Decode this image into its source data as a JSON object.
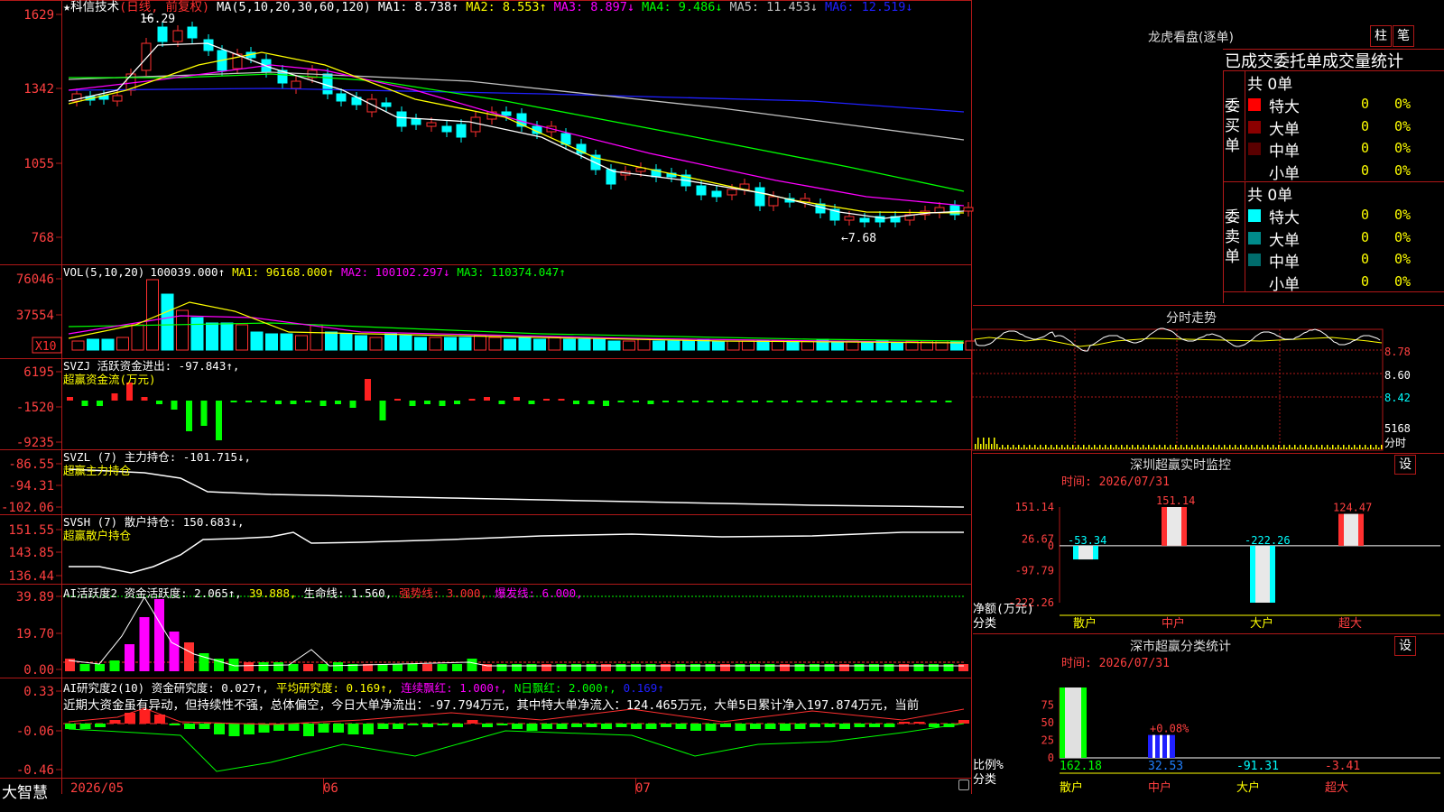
{
  "stock": {
    "star_name": "★科信技术",
    "period": "(日线, 前复权)",
    "ma_label": "MA(5,10,20,30,60,120)",
    "ma": [
      {
        "text": "MA1: 8.738↑",
        "color": "#ffffff"
      },
      {
        "text": "MA2: 8.553↑",
        "color": "#ffff00"
      },
      {
        "text": "MA3: 8.897↓",
        "color": "#ff00ff"
      },
      {
        "text": "MA4: 9.486↓",
        "color": "#00ff00"
      },
      {
        "text": "MA5: 11.453↓",
        "color": "#c0c0c0"
      },
      {
        "text": "MA6: 12.519↓",
        "color": "#2020ff"
      }
    ],
    "y_ticks": [
      "1629",
      "1342",
      "1055",
      "768"
    ],
    "high_label": "16.29",
    "low_label": "←7.68"
  },
  "vol": {
    "label": "VOL(5,10,20)",
    "items": [
      {
        "text": "100039.000↑",
        "color": "#ffffff"
      },
      {
        "text": "MA1: 96168.000↑",
        "color": "#ffff00"
      },
      {
        "text": "MA2: 100102.297↓",
        "color": "#ff00ff"
      },
      {
        "text": "MA3: 110374.047↑",
        "color": "#00ff00"
      }
    ],
    "y_ticks": [
      "76046",
      "37554"
    ],
    "unit": "X10"
  },
  "svzj": {
    "line1": "SVZJ  活跃资金进出: -97.843↑,",
    "line2": "超赢资金流(万元)",
    "y_ticks": [
      "6195",
      "-1520",
      "-9235"
    ]
  },
  "svzl": {
    "line1": "SVZL (7) 主力持仓: -101.715↓,",
    "line2": "超赢主力持仓",
    "y_ticks": [
      "-86.55",
      "-94.31",
      "-102.06"
    ]
  },
  "svsh": {
    "line1": "SVSH (7) 散户持仓: 150.683↓,",
    "line2": "超赢散户持仓",
    "y_ticks": [
      "151.55",
      "143.85",
      "136.44"
    ]
  },
  "ai_active": {
    "items": [
      {
        "text": "AI活跃度2 资金活跃度: 2.065↑,",
        "color": "#ffffff"
      },
      {
        "text": "39.888,",
        "color": "#ffff00"
      },
      {
        "text": "生命线: 1.560,",
        "color": "#ffffff"
      },
      {
        "text": "强势线: 3.000,",
        "color": "#ff3030"
      },
      {
        "text": "爆发线: 6.000,",
        "color": "#ff00ff"
      }
    ],
    "y_ticks": [
      "39.89",
      "19.70",
      "0.00"
    ]
  },
  "ai_research": {
    "items": [
      {
        "text": "AI研究度2(10) 资金研究度: 0.027↑,",
        "color": "#ffffff"
      },
      {
        "text": "平均研究度: 0.169↑,",
        "color": "#ffff00"
      },
      {
        "text": "连续飘红: 1.000↑,",
        "color": "#ff00ff"
      },
      {
        "text": "N日飘红: 2.000↑,",
        "color": "#00ff00"
      },
      {
        "text": "0.169↑",
        "color": "#2020ff"
      }
    ],
    "comment": "近期大资金虽有异动，但持续性不强，总体偏空，今日大单净流出：-97.794万元，其中特大单净流入：124.465万元，大单5日累计净入197.874万元，当前",
    "y_ticks": [
      "0.33",
      "-0.06",
      "-0.46"
    ]
  },
  "footer": {
    "brand": "大智慧",
    "dates": [
      "2026/05",
      "06",
      "07"
    ]
  },
  "dragon": {
    "title": "龙虎看盘(逐单)",
    "btn1": "柱",
    "btn2": "笔",
    "subtitle": "已成交委托单成交量统计",
    "buy": {
      "vlabel": [
        "委",
        "买",
        "单"
      ],
      "total": "共 0单",
      "rows": [
        {
          "label": "特大",
          "count": "0",
          "pct": "0%",
          "color": "#ff0000"
        },
        {
          "label": "大单",
          "count": "0",
          "pct": "0%",
          "color": "#8b0000"
        },
        {
          "label": "中单",
          "count": "0",
          "pct": "0%",
          "color": "#5a0000"
        },
        {
          "label": "小单",
          "count": "0",
          "pct": "0%",
          "color": ""
        }
      ]
    },
    "sell": {
      "vlabel": [
        "委",
        "卖",
        "单"
      ],
      "total": "共 0单",
      "rows": [
        {
          "label": "特大",
          "count": "0",
          "pct": "0%",
          "color": "#00ffff"
        },
        {
          "label": "大单",
          "count": "0",
          "pct": "0%",
          "color": "#008b8b"
        },
        {
          "label": "中单",
          "count": "0",
          "pct": "0%",
          "color": "#006b6b"
        },
        {
          "label": "小单",
          "count": "0",
          "pct": "0%",
          "color": ""
        }
      ]
    }
  },
  "intraday": {
    "title": "分时走势",
    "y_ticks": [
      "8.78",
      "8.60",
      "8.42"
    ],
    "vol_label": "5168",
    "time_label": "分时"
  },
  "sz_monitor": {
    "title": "深圳超赢实时监控",
    "btn": "设",
    "time": "时间: 2026/07/31",
    "y_ticks": [
      "151.14",
      "26.67",
      "0",
      "-97.79",
      "-222.26"
    ],
    "ylabel1": "净额(万元)",
    "ylabel2": "分类",
    "categories": [
      "散户",
      "中户",
      "大户",
      "超大"
    ],
    "values": [
      -53.34,
      151.14,
      -222.26,
      124.47
    ],
    "value_labels": [
      "-53.34",
      "151.14",
      "-222.26",
      "124.47"
    ]
  },
  "sz_class": {
    "title": "深市超赢分类统计",
    "btn": "设",
    "time": "时间: 2026/07/31",
    "y_ticks": [
      "75",
      "50",
      "25",
      "0"
    ],
    "ylabel1": "比例%",
    "ylabel2": "分类",
    "categories": [
      "散户",
      "中户",
      "大户",
      "超大"
    ],
    "bar_values": [
      100,
      32.53,
      0,
      0
    ],
    "bar_note": "+0.08%",
    "value_labels": [
      "162.18",
      "32.53",
      "-91.31",
      "-3.41"
    ]
  },
  "colors": {
    "up": "#ff3030",
    "down": "#00ffff",
    "border": "#b01818",
    "label_red": "#ff4040"
  }
}
